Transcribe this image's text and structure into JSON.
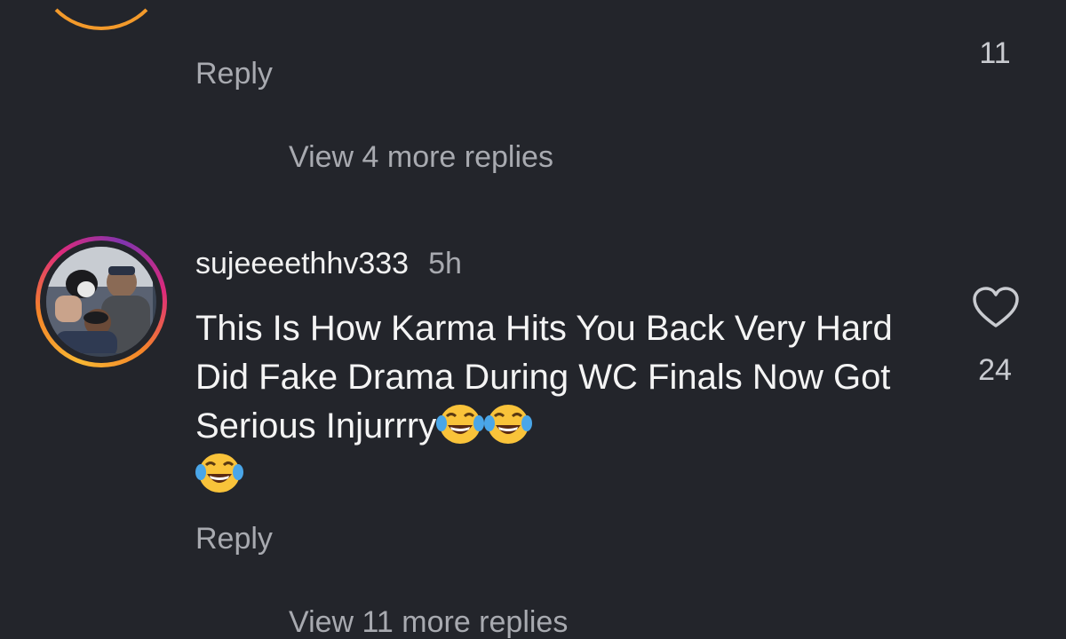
{
  "previous_comment": {
    "reply_label": "Reply",
    "like_count": "11",
    "view_more": "View 4 more replies"
  },
  "comment": {
    "username": "sujeeeethhv333",
    "time": "5h",
    "text": "This Is How Karma Hits You Back Very Hard Did Fake Drama During WC Finals Now Got Serious Injurrry",
    "emojis": [
      "face-with-tears-of-joy",
      "face-with-tears-of-joy",
      "face-with-tears-of-joy"
    ],
    "like_icon": "heart-outline-icon",
    "like_count": "24",
    "reply_label": "Reply",
    "view_more": "View 11 more replies"
  },
  "colors": {
    "background": "#23252b",
    "primary_text": "#f1f1f1",
    "secondary_text": "#a8aab0",
    "story_ring_start": "#f7b733",
    "story_ring_end": "#8134af"
  }
}
